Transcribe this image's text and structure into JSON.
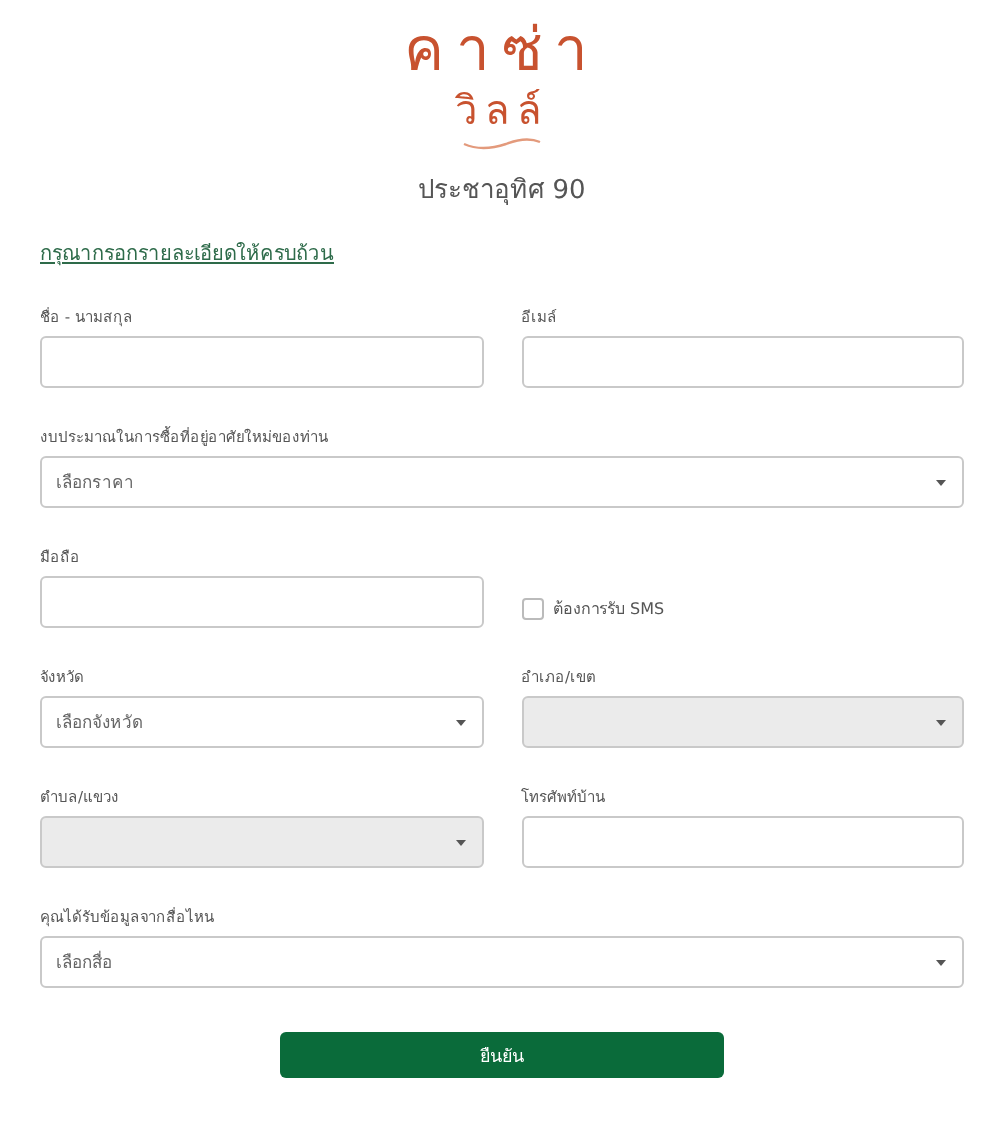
{
  "logo": {
    "line_1": "คาซ่า",
    "line_2": "วิลล์"
  },
  "subtitle": "ประชาอุทิศ 90",
  "instruction": "กรุณากรอกรายละเอียดให้ครบถ้วน",
  "rows": [
    {
      "fields": [
        {
          "kind": "text",
          "label": "ชื่อ - นามสกุล"
        },
        {
          "kind": "text",
          "label": "อีเมล์"
        }
      ]
    },
    {
      "fields": [
        {
          "kind": "select",
          "label": "งบประมาณในการซื้อที่อยู่อาศัยใหม่ของท่าน",
          "value": "เลือกราคา",
          "disabled": false
        }
      ]
    },
    {
      "fields": [
        {
          "kind": "text",
          "label": "มือถือ"
        },
        {
          "kind": "checkbox",
          "label": "ต้องการรับ SMS",
          "checked": false
        }
      ]
    },
    {
      "fields": [
        {
          "kind": "select",
          "label": "จังหวัด",
          "value": "เลือกจังหวัด",
          "disabled": false
        },
        {
          "kind": "select",
          "label": "อำเภอ/เขต",
          "disabled": true
        }
      ]
    },
    {
      "fields": [
        {
          "kind": "select",
          "label": "ตำบล/แขวง",
          "disabled": true
        },
        {
          "kind": "text",
          "label": "โทรศัพท์บ้าน"
        }
      ]
    },
    {
      "fields": [
        {
          "kind": "select",
          "label": "คุณได้รับข้อมูลจากสื่อไหน",
          "value": "เลือกสื่อ",
          "disabled": false
        }
      ]
    }
  ],
  "submit": "ยืนยัน"
}
